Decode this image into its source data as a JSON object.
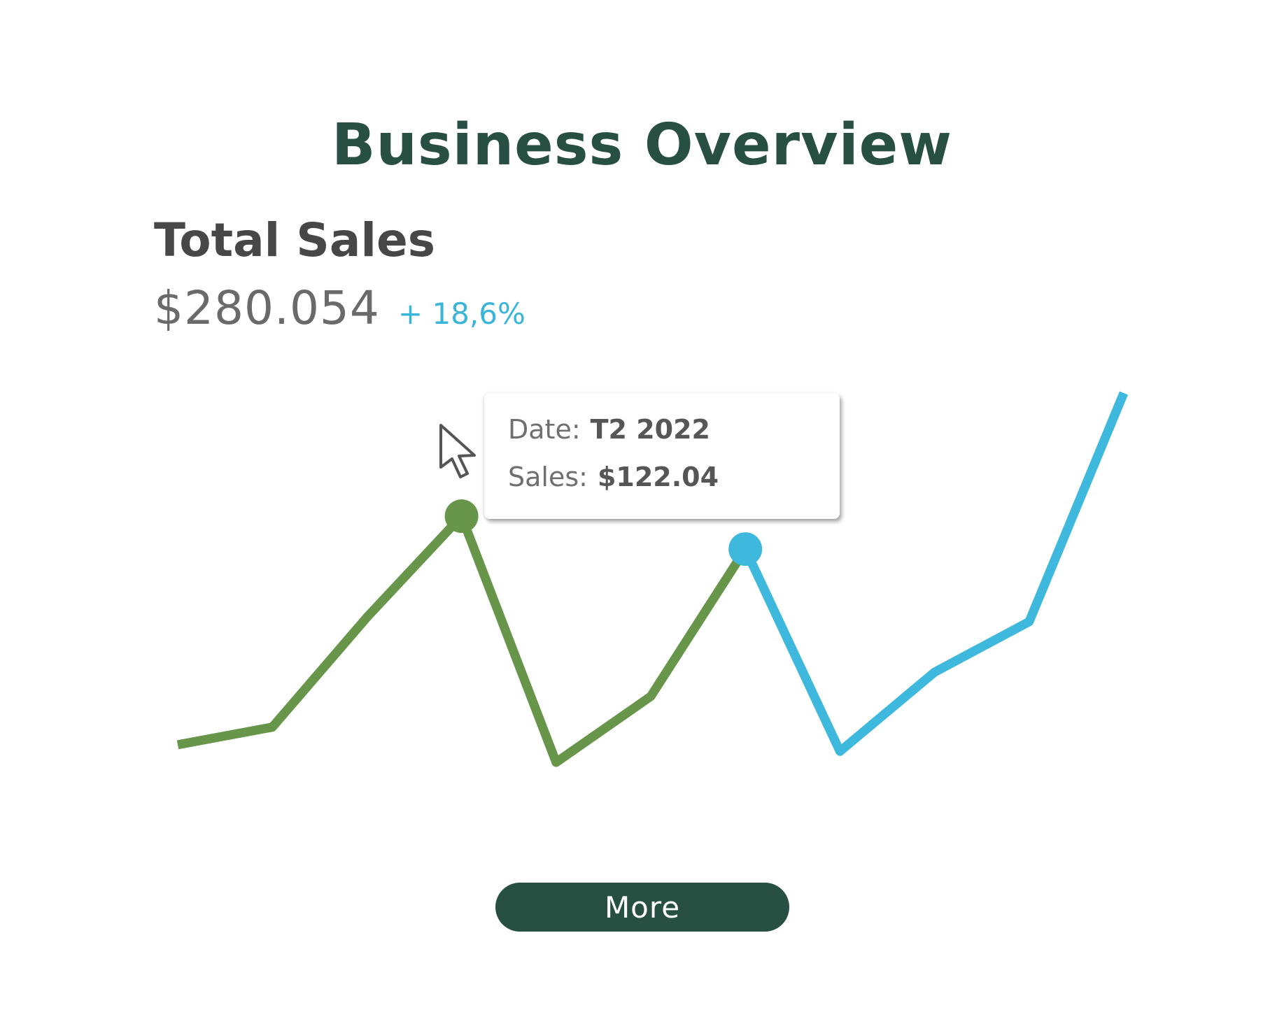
{
  "header": {
    "title": "Business Overview"
  },
  "summary": {
    "title": "Total Sales",
    "total": "$280.054",
    "change": "+ 18,6%"
  },
  "chart_data": {
    "type": "line",
    "title": "",
    "xlabel": "",
    "ylabel": "",
    "grid": false,
    "legend": "none",
    "colors": {
      "past": "#67964a",
      "recent": "#3fb8dd"
    },
    "series": [
      {
        "values": [
          4,
          12,
          62,
          108,
          -4,
          26,
          93,
          1,
          37,
          60,
          164
        ],
        "highlight_split_index": 6
      }
    ],
    "highlighted_points": [
      3,
      6
    ]
  },
  "tooltip": {
    "date_label": "Date:",
    "date_value": "T2 2022",
    "sales_label": "Sales:",
    "sales_value": "$122.04"
  },
  "icons": {
    "cursor": "cursor-arrow-icon"
  },
  "actions": {
    "more_label": "More"
  }
}
